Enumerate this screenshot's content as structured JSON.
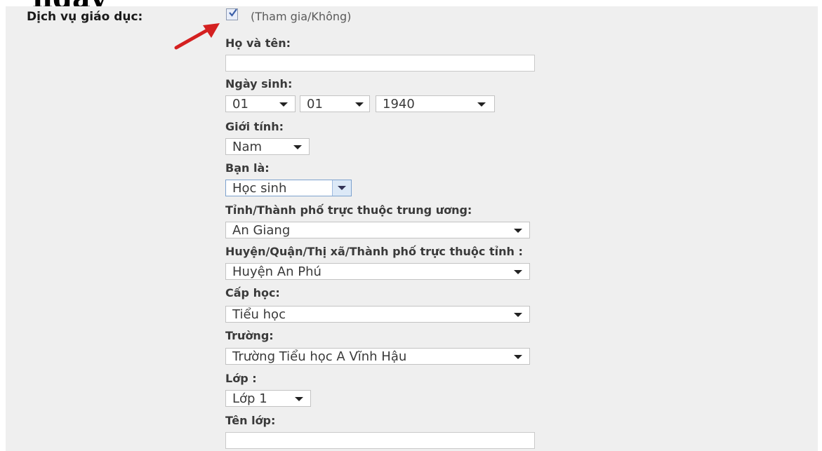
{
  "page": {
    "heading_fragment": "ngay"
  },
  "service": {
    "label": "Dịch vụ giáo dục:",
    "checked": true,
    "hint": "(Tham gia/Không)"
  },
  "fields": {
    "name_label": "Họ và tên:",
    "name_value": "",
    "dob_label": "Ngày sinh:",
    "dob_day": "01",
    "dob_month": "01",
    "dob_year": "1940",
    "gender_label": "Giới tính:",
    "gender_value": "Nam",
    "role_label": "Bạn là:",
    "role_value": "Học sinh",
    "province_label": "Tỉnh/Thành phố trực thuộc trung ương:",
    "province_value": "An Giang",
    "district_label": "Huyện/Quận/Thị xã/Thành phố trực thuộc tỉnh :",
    "district_value": "Huyện An Phú",
    "level_label": "Cấp học:",
    "level_value": "Tiểu học",
    "school_label": "Trường:",
    "school_value": "Trường Tiểu học A Vĩnh Hậu",
    "grade_label": "Lớp :",
    "grade_value": "Lớp 1",
    "class_name_label": "Tên lớp:",
    "class_name_value": ""
  },
  "colors": {
    "panel_bg": "#efefef",
    "arrow": "#d42020",
    "focus_border": "#7da2ce"
  },
  "icons": [
    "checkbox-check-icon",
    "red-arrow-icon",
    "dropdown-caret-icon"
  ]
}
